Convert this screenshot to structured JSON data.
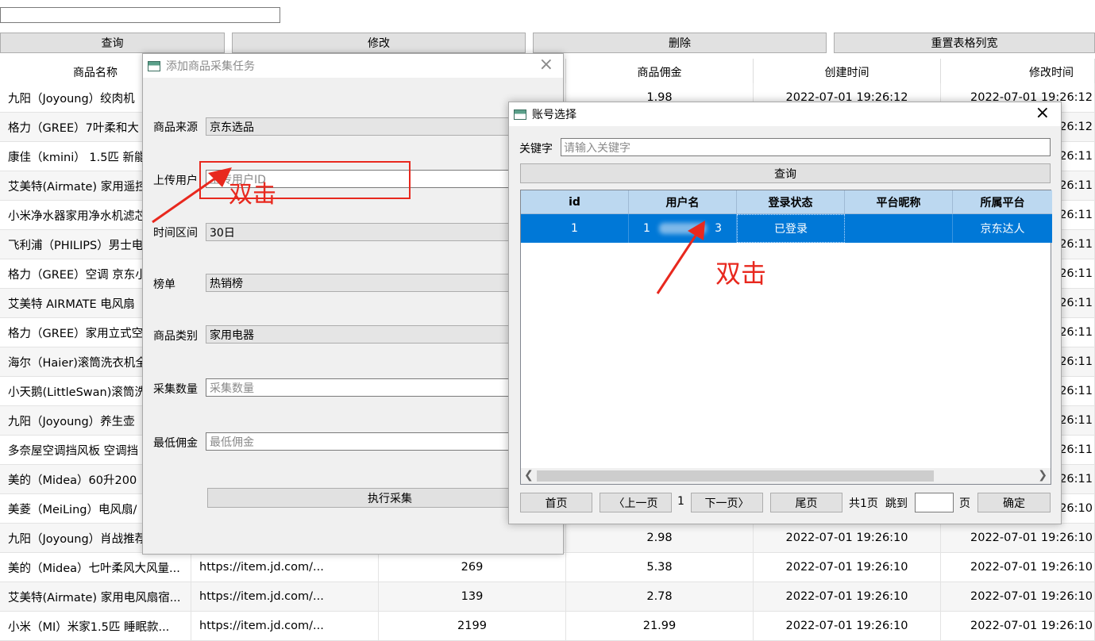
{
  "toolbar": {
    "query": "查询",
    "edit": "修改",
    "delete": "删除",
    "reset_width": "重置表格列宽"
  },
  "table": {
    "headers": [
      "商品名称",
      "",
      "",
      "商品佣金",
      "创建时间",
      "修改时间"
    ],
    "rows": [
      [
        "九阳（Joyoung）绞肉机",
        "",
        "",
        "1.98",
        "2022-07-01 19:26:12",
        "2022-07-01 19:26:12"
      ],
      [
        "格力（GREE）7叶柔和大",
        "",
        "",
        "",
        "",
        "19:26:12"
      ],
      [
        "康佳（kmini） 1.5匹 新能",
        "",
        "",
        "",
        "",
        "19:26:11"
      ],
      [
        "艾美特(Airmate) 家用遥控",
        "",
        "",
        "",
        "",
        "19:26:11"
      ],
      [
        "小米净水器家用净水机滤芯",
        "",
        "",
        "",
        "",
        "19:26:11"
      ],
      [
        "飞利浦（PHILIPS）男士电",
        "",
        "",
        "",
        "",
        "19:26:11"
      ],
      [
        "格力（GREE）空调 京东小",
        "",
        "",
        "",
        "",
        "19:26:11"
      ],
      [
        "艾美特 AIRMATE 电风扇",
        "",
        "",
        "",
        "",
        "19:26:11"
      ],
      [
        "格力（GREE）家用立式空",
        "",
        "",
        "",
        "",
        "19:26:11"
      ],
      [
        "海尔（Haier)滚筒洗衣机全",
        "",
        "",
        "",
        "",
        "19:26:11"
      ],
      [
        "小天鹅(LittleSwan)滚筒洗",
        "",
        "",
        "",
        "",
        "19:26:11"
      ],
      [
        "九阳（Joyoung）养生壶",
        "",
        "",
        "",
        "",
        "19:26:11"
      ],
      [
        "多奈屋空调挡风板 空调挡",
        "",
        "",
        "",
        "",
        "19:26:11"
      ],
      [
        "美的（Midea）60升200",
        "",
        "",
        "",
        "",
        "19:26:11"
      ],
      [
        "美菱（MeiLing）电风扇/",
        "",
        "",
        "",
        "",
        "19:26:10"
      ],
      [
        "九阳（Joyoung）肖战推荐",
        "",
        "",
        "2.98",
        "2022-07-01 19:26:10",
        "2022-07-01 19:26:10"
      ],
      [
        "美的（Midea）七叶柔风大风量...",
        "https://item.jd.com/...",
        "269",
        "5.38",
        "2022-07-01 19:26:10",
        "2022-07-01 19:26:10"
      ],
      [
        "艾美特(Airmate) 家用电风扇宿...",
        "https://item.jd.com/...",
        "139",
        "2.78",
        "2022-07-01 19:26:10",
        "2022-07-01 19:26:10"
      ],
      [
        "小米（MI）米家1.5匹 睡眠款...",
        "https://item.jd.com/...",
        "2199",
        "21.99",
        "2022-07-01 19:26:10",
        "2022-07-01 19:26:10"
      ]
    ]
  },
  "dialog_task": {
    "title": "添加商品采集任务",
    "fields": {
      "source_label": "商品来源",
      "source_value": "京东选品",
      "uploader_label": "上传用户",
      "uploader_placeholder": "上传用户ID",
      "period_label": "时间区间",
      "period_value": "30日",
      "ranking_label": "榜单",
      "ranking_value": "热销榜",
      "category_label": "商品类别",
      "category_value": "家用电器",
      "count_label": "采集数量",
      "count_placeholder": "采集数量",
      "min_commission_label": "最低佣金",
      "min_commission_placeholder": "最低佣金"
    },
    "execute_button": "执行采集",
    "annotation": "双击"
  },
  "dialog_account": {
    "title": "账号选择",
    "keyword_label": "关键字",
    "keyword_placeholder": "请输入关键字",
    "query_button": "查询",
    "headers": [
      "id",
      "用户名",
      "登录状态",
      "平台昵称",
      "所属平台"
    ],
    "rows": [
      [
        "1",
        "1",
        "已登录",
        "",
        "京东达人"
      ]
    ],
    "username_tail": "3",
    "annotation": "双击",
    "pagination": {
      "first": "首页",
      "prev": "〈上一页",
      "page": "1",
      "next": "下一页〉",
      "last": "尾页",
      "total": "共1页",
      "jump": "跳到",
      "page_unit": "页",
      "confirm": "确定"
    }
  },
  "colors": {
    "selection": "#0078d7",
    "header_blue": "#bcd8f0",
    "annotation_red": "#e8281e"
  }
}
